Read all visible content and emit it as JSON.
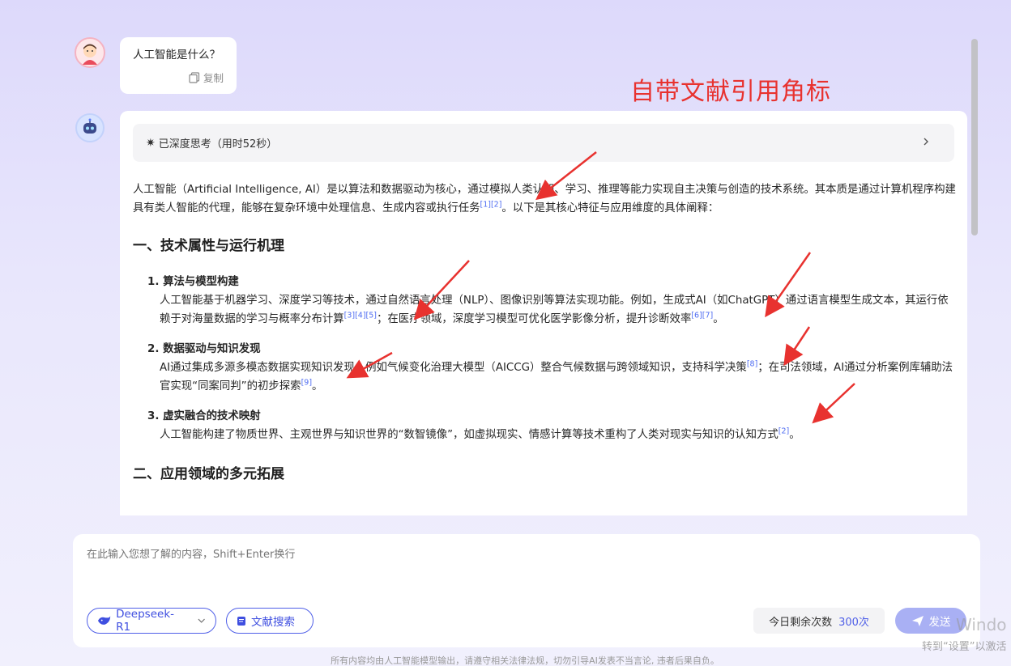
{
  "colors": {
    "accent": "#4f5fe8",
    "annotation": "#e8322f",
    "reference": "#4e6cf2"
  },
  "user_message": {
    "text": "人工智能是什么？",
    "copy_label": "复制"
  },
  "annotation_text": "自带文献引用角标",
  "answer": {
    "think_label": "已深度思考（用时52秒）",
    "intro": {
      "before": "人工智能（Artificial Intelligence, AI）是以算法和数据驱动为核心，通过模拟人类认知、学习、推理等能力实现自主决策与创造的技术系统。其本质是通过计算机程序构建具有类人智能的代理，能够在复杂环境中处理信息、生成内容或执行任务",
      "refs": "[1][2]",
      "after": "。以下是其核心特征与应用维度的具体阐释："
    },
    "section1_title": "一、技术属性与运行机理",
    "items": [
      {
        "title": "1. 算法与模型构建",
        "p1": "人工智能基于机器学习、深度学习等技术，通过自然语言处理（NLP）、图像识别等算法实现功能。例如，生成式AI（如ChatGPT）通过语言模型生成文本，其运行依赖于对海量数据的学习与概率分布计算",
        "r1": "[3][4][5]",
        "p2": "；在医疗领域，深度学习模型可优化医学影像分析，提升诊断效率",
        "r2": "[6][7]",
        "p3": "。"
      },
      {
        "title": "2. 数据驱动与知识发现",
        "p1": "AI通过集成多源多模态数据实现知识发现，例如气候变化治理大模型（AICCG）整合气候数据与跨领域知识，支持科学决策",
        "r1": "[8]",
        "p2": "；在司法领域，AI通过分析案例库辅助法官实现“同案同判”的初步探索",
        "r2": "[9]",
        "p3": "。"
      },
      {
        "title": "3. 虚实融合的技术映射",
        "p1": "人工智能构建了物质世界、主观世界与知识世界的“数智镜像”，如虚拟现实、情感计算等技术重构了人类对现实与知识的认知方式",
        "r1": "[2]",
        "p2": "。",
        "r2": "",
        "p3": ""
      }
    ],
    "section2_title": "二、应用领域的多元拓展"
  },
  "input": {
    "placeholder": "在此输入您想了解的内容，Shift+Enter换行",
    "model_label": "Deepseek-R1",
    "search_label": "文献搜索",
    "quota_label": "今日剩余次数",
    "quota_value": "300次",
    "send_label": "发送"
  },
  "watermark": {
    "line1": "Windo",
    "line2": "转到“设置”以激活"
  },
  "footer_text": "所有内容均由人工智能模型输出，请遵守相关法律法规，切勿引导AI发表不当言论, 违者后果自负。"
}
